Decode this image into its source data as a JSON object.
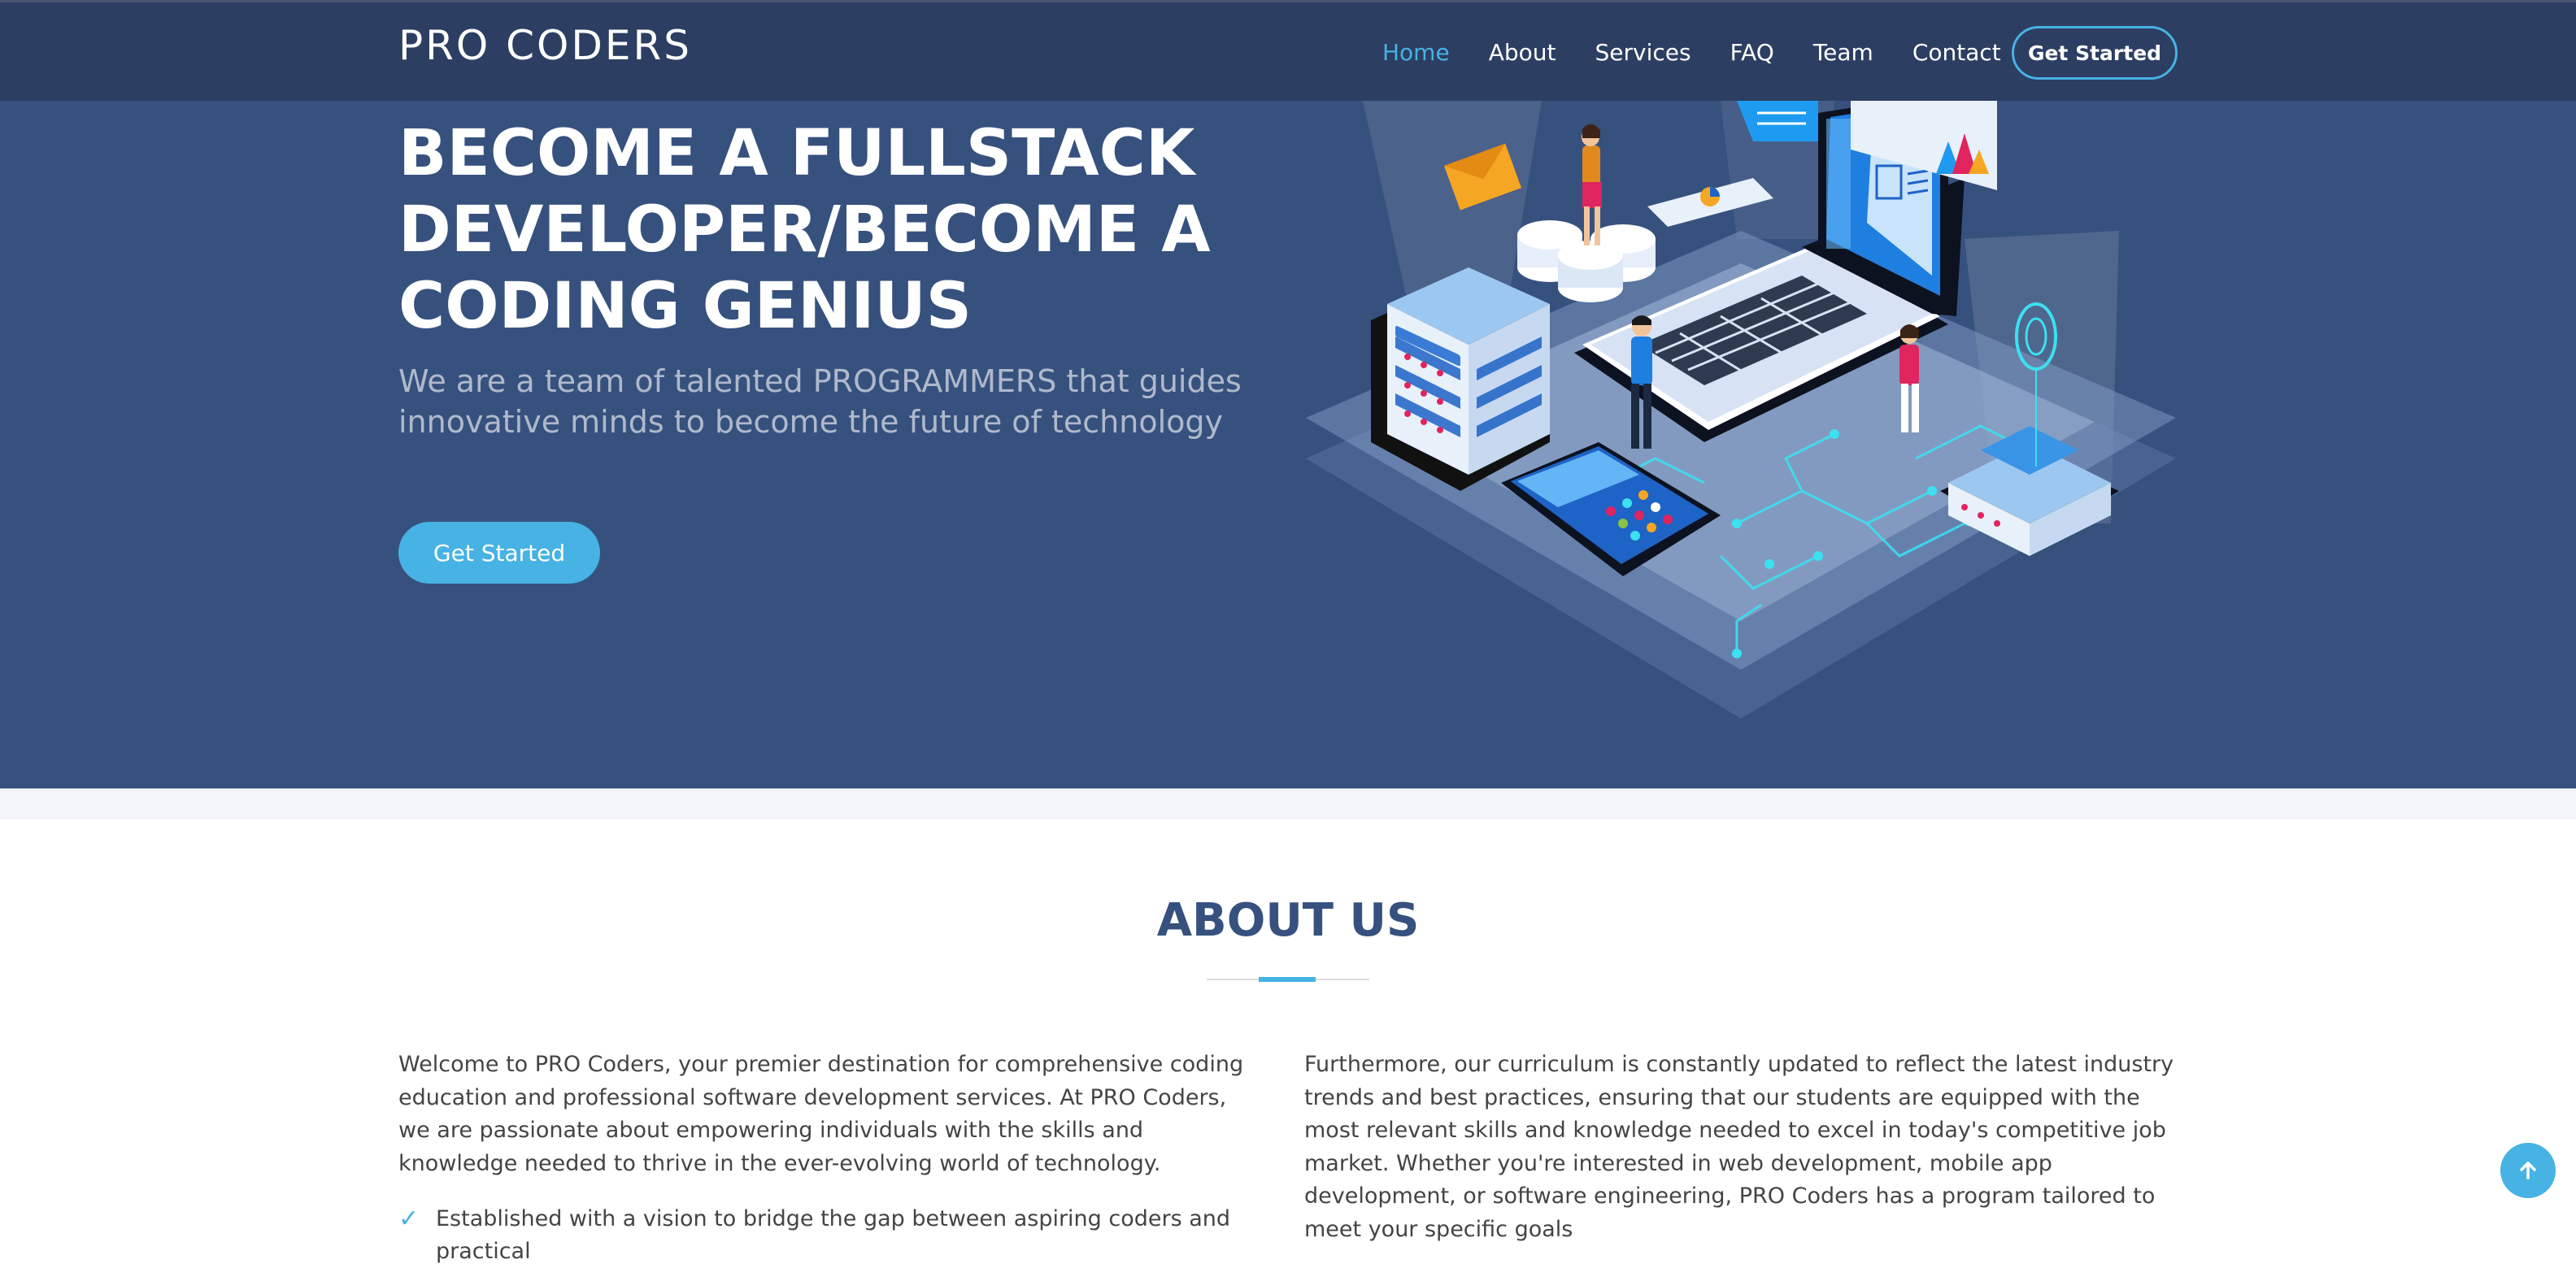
{
  "header": {
    "logo": "PRO CODERS",
    "nav": [
      {
        "label": "Home",
        "active": true
      },
      {
        "label": "About"
      },
      {
        "label": "Services"
      },
      {
        "label": "FAQ"
      },
      {
        "label": "Team"
      },
      {
        "label": "Contact"
      }
    ],
    "cta_label": "Get Started"
  },
  "hero": {
    "title": "BECOME A FULLSTACK DEVELOPER/BECOME A CODING GENIUS",
    "subtitle": "We are a team of talented PROGRAMMERS that guides innovative minds to become the future of technology",
    "button_label": "Get Started",
    "illustration": "isometric-laptop-server-illustration"
  },
  "about": {
    "title": "ABOUT US",
    "left_paragraph": "Welcome to PRO Coders, your premier destination for comprehensive coding education and professional software development services. At PRO Coders, we are passionate about empowering individuals with the skills and knowledge needed to thrive in the ever-evolving world of technology.",
    "list_items": [
      "Established with a vision to bridge the gap between aspiring coders and practical"
    ],
    "right_paragraph": "Furthermore, our curriculum is constantly updated to reflect the latest industry trends and best practices, ensuring that our students are equipped with the most relevant skills and knowledge needed to excel in today's competitive job market. Whether you're interested in web development, mobile app development, or software engineering, PRO Coders has a program tailored to meet your specific goals"
  },
  "icons": {
    "check": "check-icon",
    "back_to_top": "arrow-up-icon"
  },
  "colors": {
    "header_bg": "#2c3e62",
    "hero_bg": "#37517e",
    "accent": "#47b2e4",
    "heading": "#37517e",
    "body_text": "#444444"
  }
}
